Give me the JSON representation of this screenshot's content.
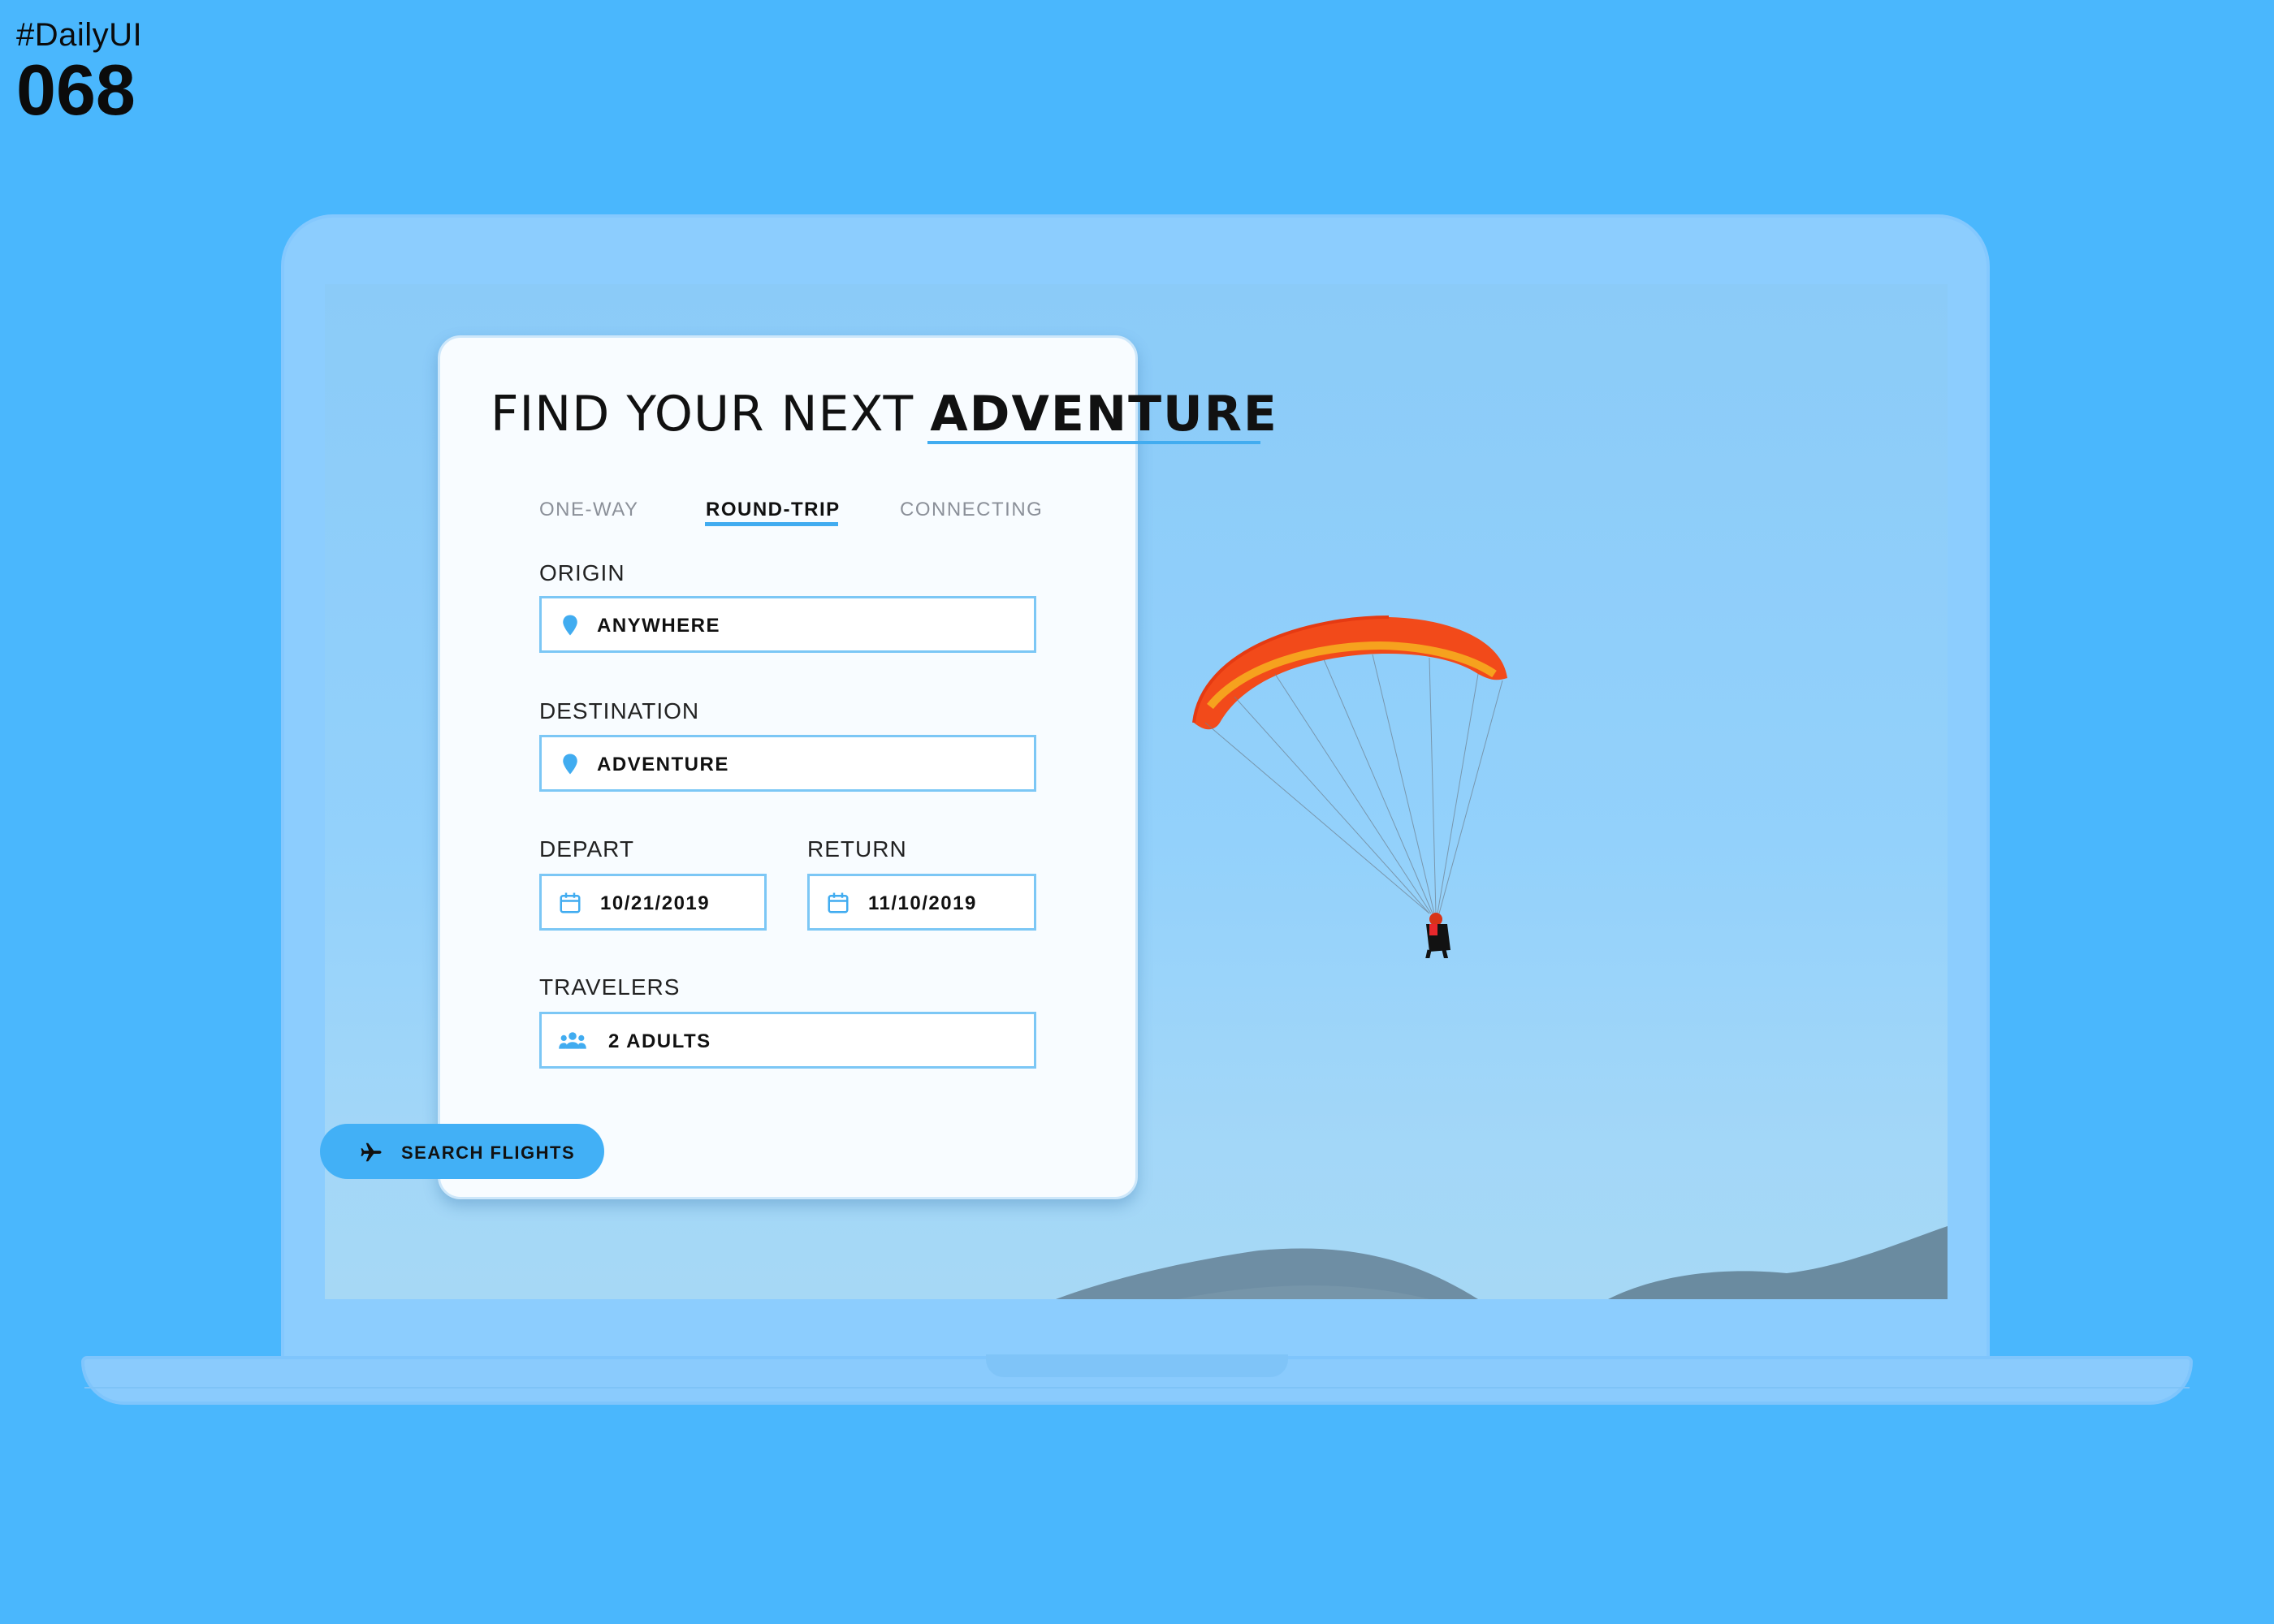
{
  "corner": {
    "hashtag": "#DailyUI",
    "number": "068"
  },
  "headline": {
    "light": "FIND YOUR NEXT ",
    "bold": "ADVENTURE"
  },
  "tabs": [
    {
      "label": "ONE-WAY",
      "active": false
    },
    {
      "label": "ROUND-TRIP",
      "active": true
    },
    {
      "label": "CONNECTING",
      "active": false
    }
  ],
  "origin": {
    "label": "ORIGIN",
    "value": "ANYWHERE",
    "icon": "location-pin-icon"
  },
  "destination": {
    "label": "DESTINATION",
    "value": "ADVENTURE",
    "icon": "location-pin-icon"
  },
  "depart": {
    "label": "DEPART",
    "value": "10/21/2019",
    "icon": "calendar-icon"
  },
  "return": {
    "label": "RETURN",
    "value": "11/10/2019",
    "icon": "calendar-icon"
  },
  "travelers": {
    "label": "TRAVELERS",
    "value": "2 ADULTS",
    "icon": "people-icon"
  },
  "search_button": {
    "label": "SEARCH FLIGHTS",
    "icon": "airplane-icon"
  },
  "colors": {
    "background": "#4AB7FD",
    "accent": "#41ACF0",
    "field_border": "#7CC7F5",
    "card": "#F8FCFF",
    "laptop": "#8CCDFE"
  }
}
